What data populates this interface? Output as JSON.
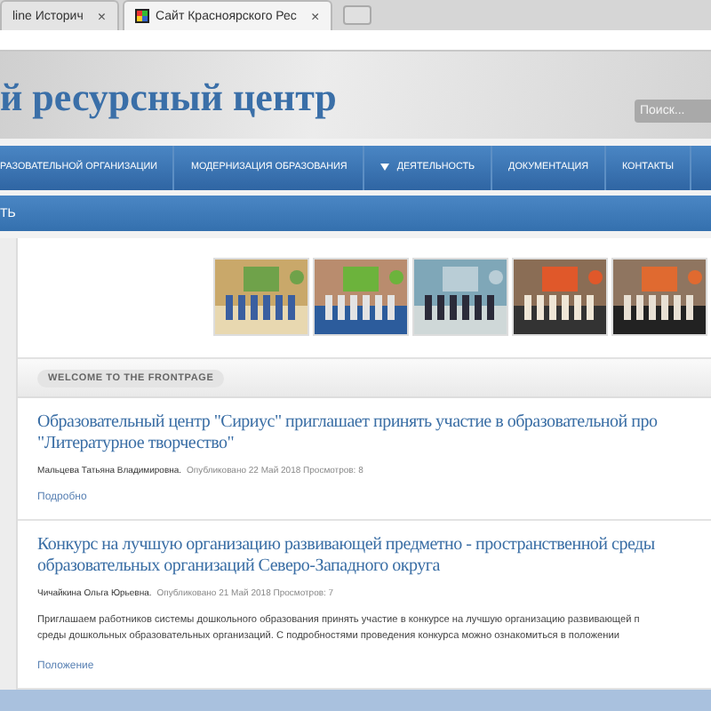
{
  "browser": {
    "tabs": [
      {
        "title": "line Историч",
        "selected": false
      },
      {
        "title": "Сайт Красноярского Рес",
        "selected": true
      }
    ],
    "close_label": "×"
  },
  "header": {
    "title": "й ресурсный центр",
    "search": {
      "placeholder": "Поиск..."
    }
  },
  "nav": {
    "items": [
      {
        "label": "РАЗОВАТЕЛЬНОЙ ОРГАНИЗАЦИИ",
        "dropdown": false
      },
      {
        "label": "МОДЕРНИЗАЦИЯ ОБРАЗОВАНИЯ",
        "dropdown": false
      },
      {
        "label": "ДЕЯТЕЛЬНОСТЬ",
        "dropdown": true
      },
      {
        "label": "ДОКУМЕНТАЦИЯ",
        "dropdown": false
      },
      {
        "label": "КОНТАКТЫ",
        "dropdown": false
      }
    ]
  },
  "subnav": {
    "items": [
      "ТЬ"
    ]
  },
  "section_badge": "WELCOME TO THE FRONTPAGE",
  "articles": [
    {
      "title": "Образовательный центр \"Сириус\" приглашает принять участие в образовательной про",
      "title_line2": "\"Литературное творчество\"",
      "author": "Мальцева Татьяна Владимировна.",
      "meta": "Опубликовано 22 Май 2018 Просмотров: 8",
      "link": "Подробно"
    },
    {
      "title": "Конкурс на лучшую организацию развивающей предметно - пространственной среды",
      "title_line2": "образовательных организаций Северо-Западного округа",
      "author": "Чичайкина Ольга Юрьевна.",
      "meta": "Опубликовано 21 Май 2018 Просмотров: 7",
      "body": [
        "Приглашаем работников системы дошкольного образования принять участие в конкурсе на лучшую организацию развивающей п",
        "среды дошкольных образовательных организаций. С подробностями проведения конкурса можно ознакомиться в положении"
      ],
      "link": "Положение"
    }
  ]
}
